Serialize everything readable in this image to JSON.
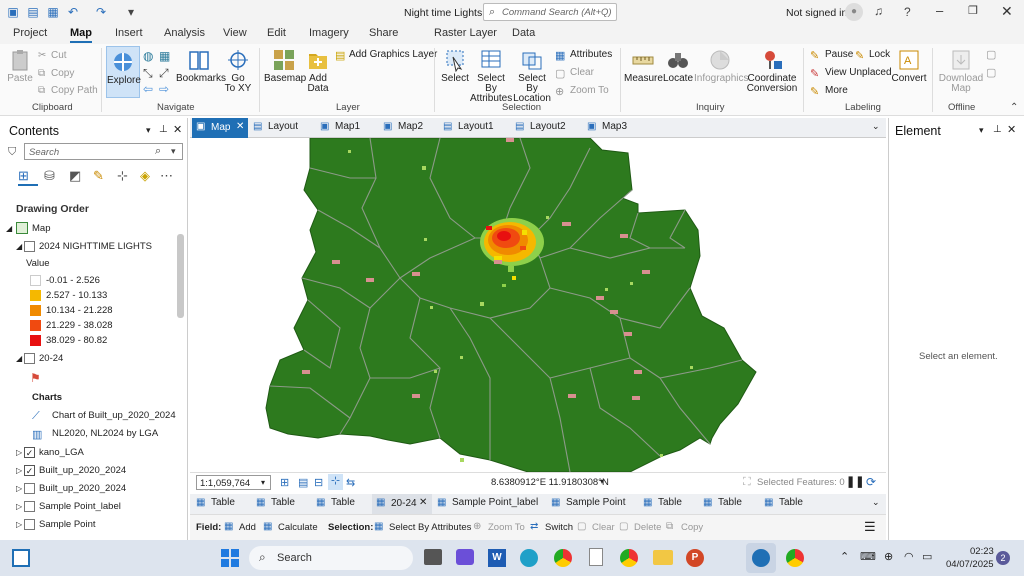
{
  "window": {
    "title": "Night time Lights",
    "search_placeholder": "Command Search (Alt+Q)",
    "signin": "Not signed in"
  },
  "menu_tabs": [
    "Project",
    "Map",
    "Insert",
    "Analysis",
    "View",
    "Edit",
    "Imagery",
    "Share",
    "Raster Layer",
    "Data"
  ],
  "ribbon": {
    "clipboard": {
      "paste": "Paste",
      "cut": "Cut",
      "copy": "Copy",
      "copy_path": "Copy Path",
      "label": "Clipboard"
    },
    "navigate": {
      "explore": "Explore",
      "bookmarks": "Bookmarks",
      "goto": "Go",
      "goto2": "To XY",
      "label": "Navigate"
    },
    "layer": {
      "basemap": "Basemap",
      "add": "Add",
      "add2": "Data",
      "add_graphics": "Add Graphics Layer",
      "label": "Layer"
    },
    "selection": {
      "select": "Select",
      "select_attr1": "Select By",
      "select_attr2": "Attributes",
      "select_loc1": "Select By",
      "select_loc2": "Location",
      "attributes": "Attributes",
      "clear": "Clear",
      "zoom_to": "Zoom To",
      "label": "Selection"
    },
    "inquiry": {
      "measure": "Measure",
      "locate": "Locate",
      "infographics": "Infographics",
      "coord1": "Coordinate",
      "coord2": "Conversion",
      "label": "Inquiry"
    },
    "labeling": {
      "pause": "Pause",
      "lock": "Lock",
      "view_unplaced": "View Unplaced",
      "more": "More",
      "convert": "Convert",
      "label": "Labeling"
    },
    "offline": {
      "download1": "Download",
      "download2": "Map",
      "label": "Offline"
    }
  },
  "contents": {
    "title": "Contents",
    "search_placeholder": "Search",
    "drawing_order": "Drawing Order",
    "map": "Map",
    "layer_ntl": "2024 NIGHTTIME LIGHTS",
    "value": "Value",
    "legend": [
      {
        "label": "-0.01 - 2.526",
        "color": "#ffffff"
      },
      {
        "label": "2.527 - 10.133",
        "color": "#f5b800"
      },
      {
        "label": "10.134 - 21.228",
        "color": "#f08a00"
      },
      {
        "label": "21.229 - 38.028",
        "color": "#f04a10"
      },
      {
        "label": "38.029 - 80.82",
        "color": "#e81010"
      }
    ],
    "layer_2024": "20-24",
    "charts": "Charts",
    "chart1": "Chart of Built_up_2020_2024",
    "chart2": "NL2020, NL2024 by LGA",
    "layers_bottom": [
      {
        "label": "kano_LGA",
        "checked": true
      },
      {
        "label": "Built_up_2020_2024",
        "checked": true
      },
      {
        "label": "Built_up_2020_2024",
        "checked": false
      },
      {
        "label": "Sample Point_label",
        "checked": false
      },
      {
        "label": "Sample Point",
        "checked": false
      }
    ]
  },
  "view_tabs": [
    "Map",
    "Layout",
    "Map1",
    "Map2",
    "Layout1",
    "Layout2",
    "Map3"
  ],
  "element_pane": {
    "title": "Element",
    "message": "Select an element."
  },
  "map_status": {
    "scale": "1:1,059,764",
    "coords": "8.6380912°E 11.9180308°N",
    "selected": "Selected Features: 0"
  },
  "table_tabs": [
    "Table",
    "Table",
    "Table",
    "20-24",
    "Sample Point_label",
    "Sample Point",
    "Table",
    "Table",
    "Table"
  ],
  "field_bar": {
    "field": "Field:",
    "add": "Add",
    "calculate": "Calculate",
    "selection": "Selection:",
    "select_by_attr": "Select By Attributes",
    "zoom_to": "Zoom To",
    "switch": "Switch",
    "clear": "Clear",
    "delete": "Delete",
    "copy": "Copy"
  },
  "taskbar": {
    "search": "Search",
    "time": "02:23",
    "date": "04/07/2025",
    "badge": "2"
  },
  "colors": {
    "land": "#2d7a1e",
    "boundary": "#8c9a88",
    "accent": "#1f6fb5"
  }
}
